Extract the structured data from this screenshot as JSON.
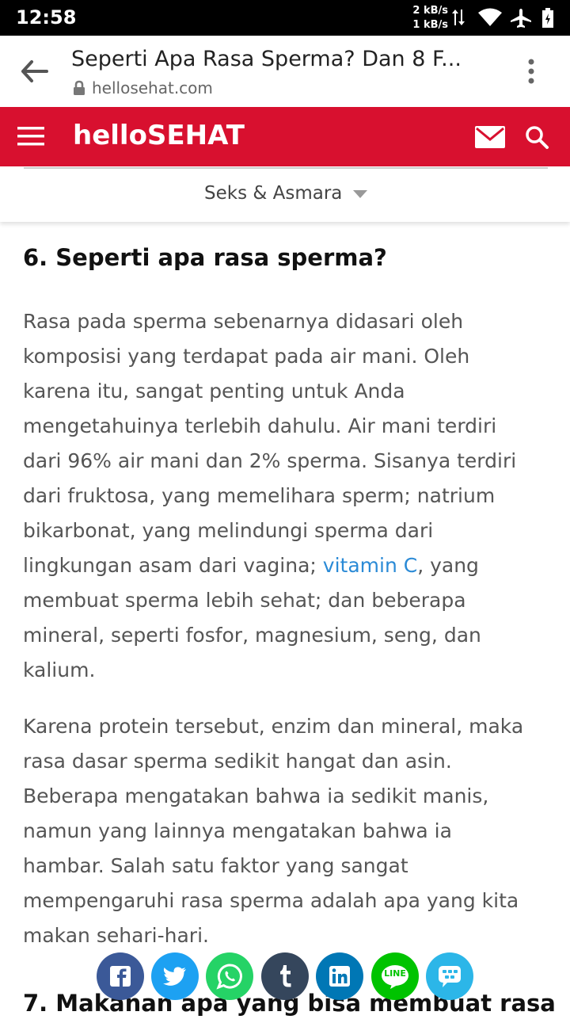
{
  "status": {
    "time": "12:58",
    "up_rate": "2 kB/s",
    "down_rate": "1 kB/s"
  },
  "browser": {
    "page_title": "Seperti Apa Rasa Sperma? Dan 8 F...",
    "domain": "hellosehat.com"
  },
  "site": {
    "logo": "helloSEHAT",
    "category": "Seks & Asmara"
  },
  "article": {
    "h6": "6. Seperti apa rasa sperma?",
    "p1_lines": [
      "Rasa pada sperma sebenarnya didasari oleh",
      "komposisi yang terdapat pada air mani. Oleh",
      "karena itu, sangat penting untuk Anda",
      "mengetahuinya terlebih dahulu. Air mani terdiri",
      "dari 96% air mani dan 2% sperma. Sisanya terdiri",
      "dari fruktosa, yang memelihara sperm; natrium",
      "bikarbonat, yang melindungi sperma dari"
    ],
    "p1_line8_before": "lingkungan asam dari vagina; ",
    "p1_link": "vitamin C",
    "p1_line8_after": ", yang",
    "p1_tail_lines": [
      "membuat sperma lebih sehat; dan beberapa",
      "mineral, seperti fosfor, magnesium, seng, dan",
      "kalium."
    ],
    "p2_lines": [
      "Karena protein tersebut, enzim dan mineral, maka",
      "rasa dasar sperma sedikit hangat dan asin.",
      "Beberapa mengatakan bahwa ia sedikit manis,",
      "namun yang lainnya mengatakan bahwa ia",
      "hambar. Salah satu faktor yang sangat",
      "mempengaruhi rasa sperma adalah apa yang kita",
      "makan sehari-hari."
    ],
    "h7": "7. Makanan apa yang bisa membuat rasa"
  },
  "share": {
    "line_label": "LINE",
    "colors": {
      "facebook": "#3b5998",
      "twitter": "#1da1f2",
      "whatsapp": "#25d366",
      "tumblr": "#35465c",
      "linkedin": "#0077b5",
      "line": "#00c300",
      "bbm": "#2cb6e8"
    }
  }
}
